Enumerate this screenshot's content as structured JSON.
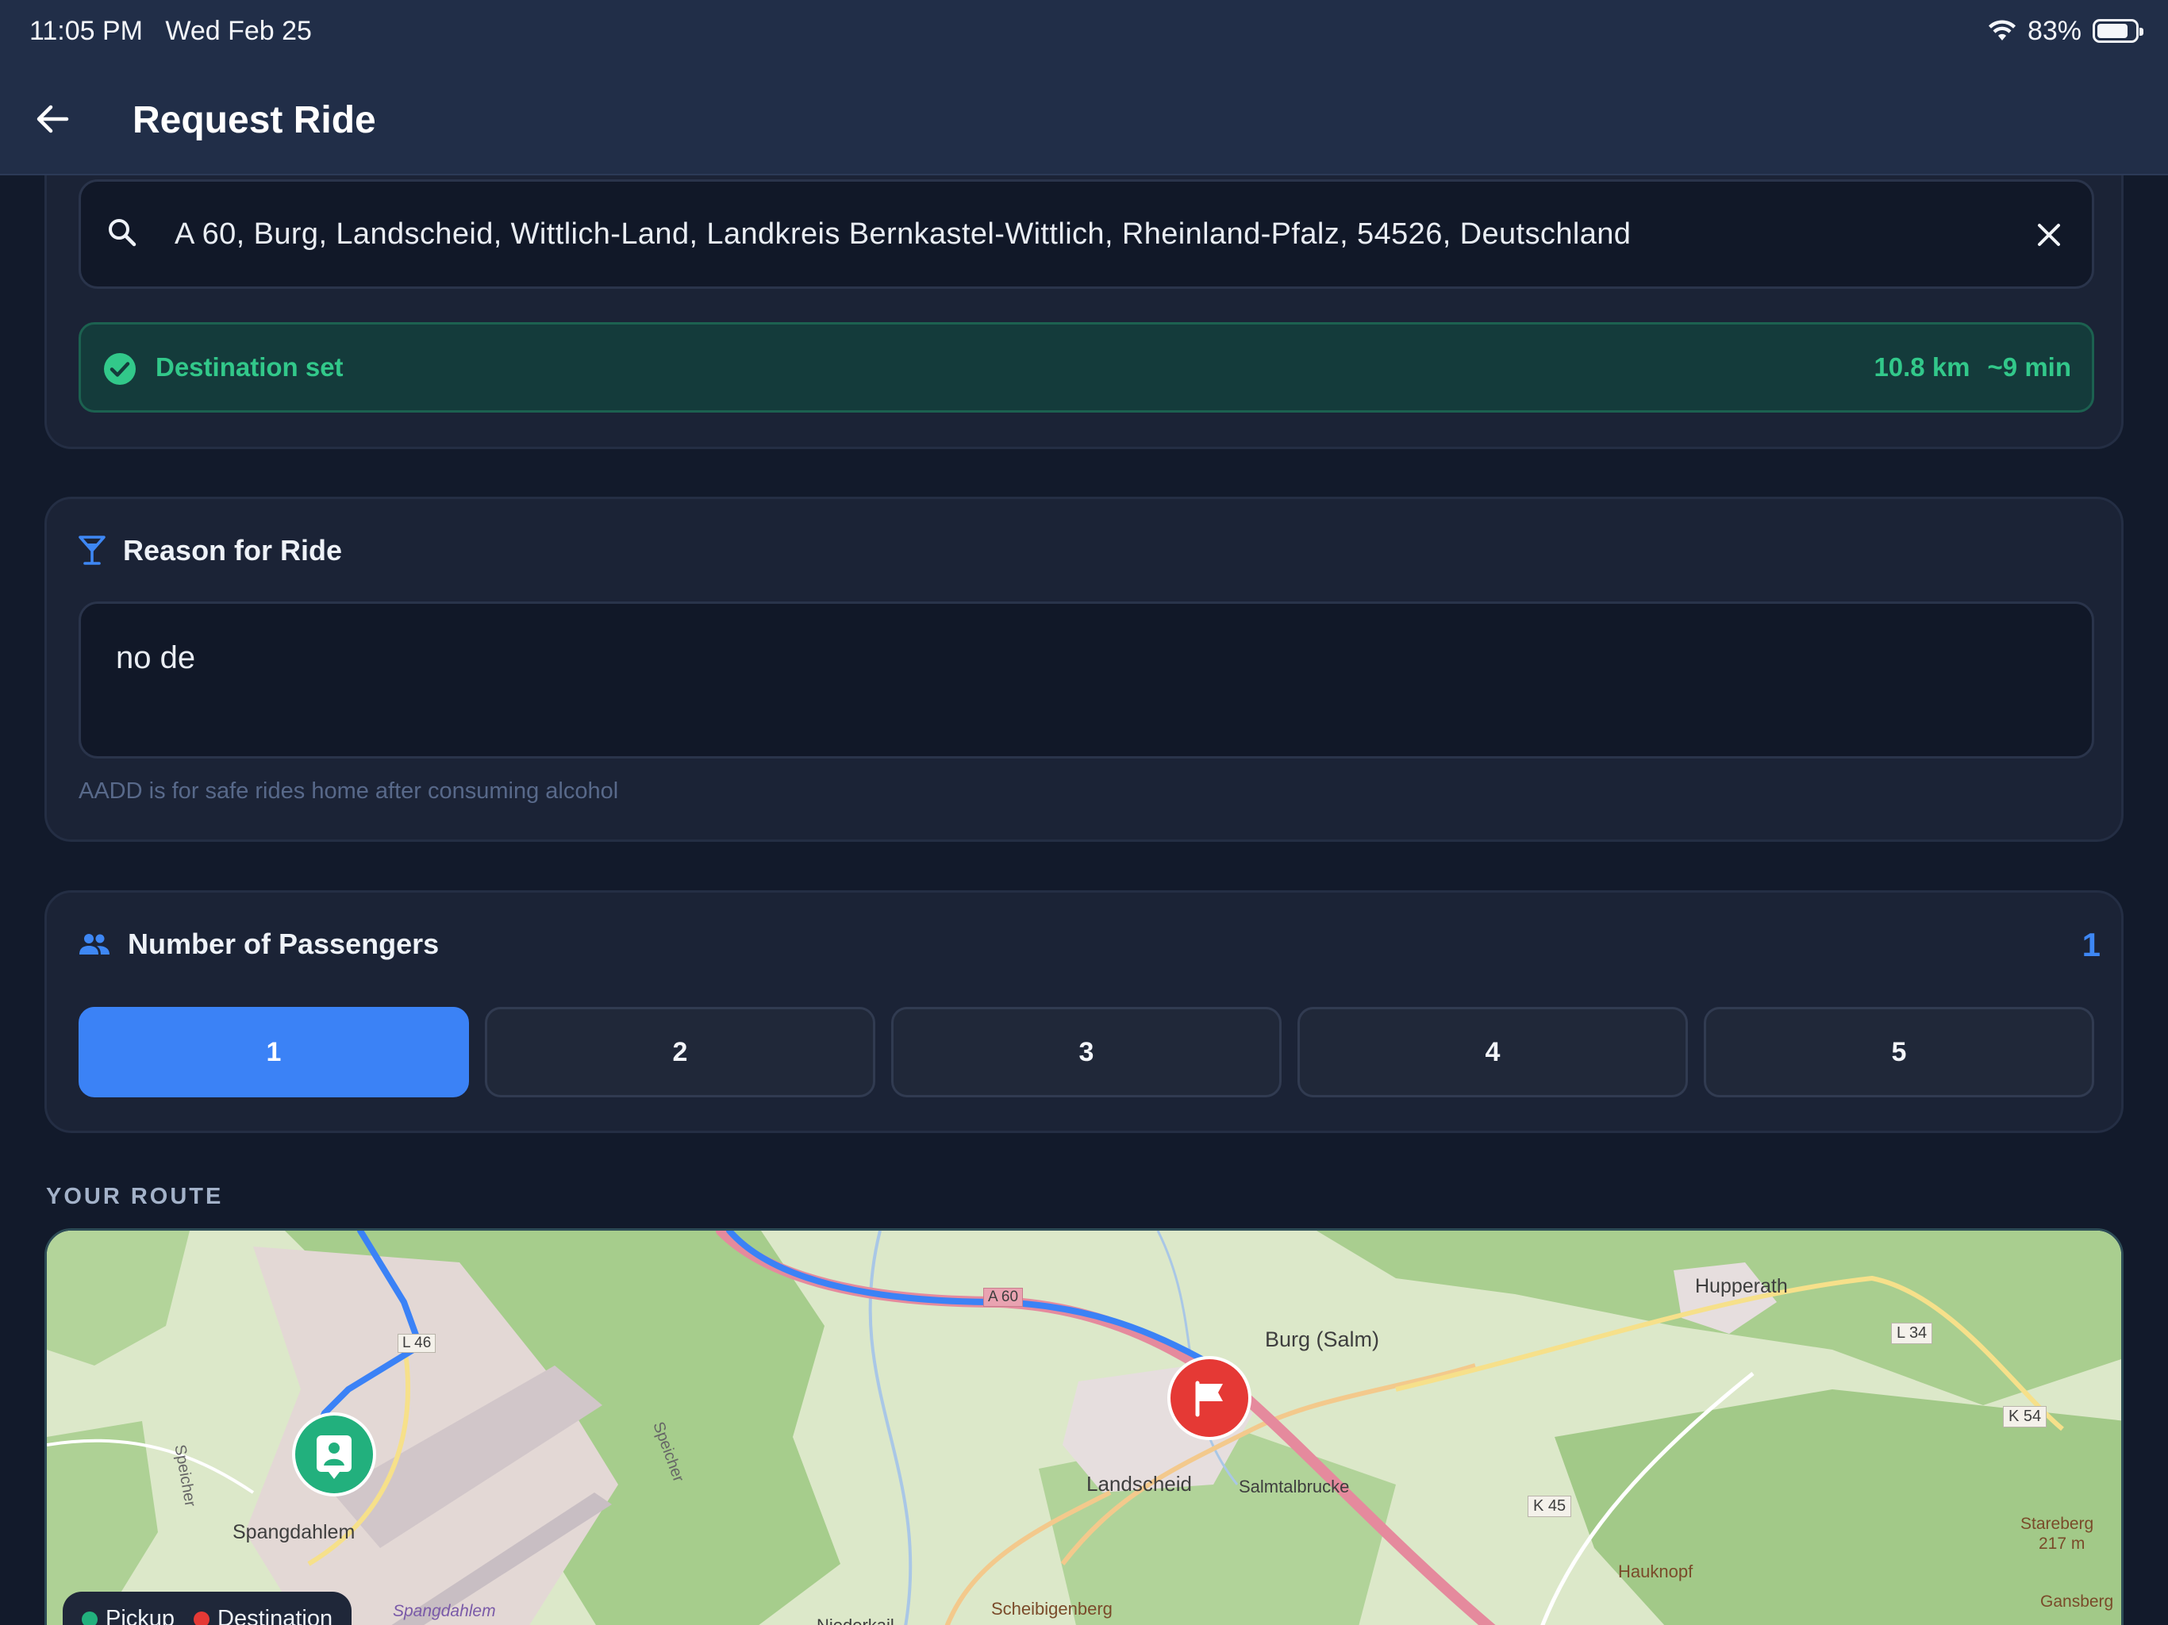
{
  "status_bar": {
    "time_date": "11:05 PM   Wed Feb 25",
    "battery": "83%",
    "battery_level": 0.83,
    "icons": [
      "wifi-icon",
      "battery-icon"
    ]
  },
  "header": {
    "back_icon": "arrow-left-icon",
    "title": "Request Ride"
  },
  "destination": {
    "search_icon": "search-icon",
    "value": "A 60, Burg, Landscheid, Wittlich-Land, Landkreis Bernkastel-Wittlich, Rheinland-Pfalz, 54526, Deutschland",
    "clear_icon": "close-icon",
    "status": {
      "icon": "check-circle-icon",
      "label": "Destination set",
      "distance": "10.8 km",
      "duration": "~9 min"
    }
  },
  "reason": {
    "icon": "cocktail-glass-icon",
    "title": "Reason for Ride",
    "value": "no de",
    "hint": "AADD is for safe rides home after consuming alcohol"
  },
  "passengers": {
    "icon": "people-icon",
    "title": "Number of Passengers",
    "selected": "1",
    "options": [
      "1",
      "2",
      "3",
      "4",
      "5"
    ]
  },
  "route": {
    "label": "YOUR ROUTE",
    "map_labels": {
      "burg": "Burg (Salm)",
      "hupperath": "Hupperath",
      "landscheid": "Landscheid",
      "salmtalbrucke": "Salmtalbrucke",
      "spangdahlem": "Spangdahlem",
      "spangdahlem_air": "Spangdahlem",
      "hauknopf": "Hauknopf",
      "scheibigenberg": "Scheibigenberg",
      "stareberg": "Stareberg",
      "stareberg_height": "217 m",
      "gansberg": "Gansberg",
      "speicher": "Speicher",
      "niederkail": "Niederkail",
      "road_l34": "L 34",
      "road_k54": "K 54",
      "road_k45": "K 45",
      "road_a60": "A 60",
      "road_l46": "L 46"
    },
    "pickup_icon": "person-pin-icon",
    "destination_icon": "flag-icon",
    "legend": {
      "pickup": "Pickup",
      "destination": "Destination",
      "pickup_color": "#22b07d",
      "destination_color": "#e53935"
    }
  },
  "colors": {
    "accent": "#3b82f6",
    "success": "#32c88a",
    "route_line": "#3b82f6",
    "destination_pin": "#e53935",
    "pickup_pin": "#22b07d"
  }
}
